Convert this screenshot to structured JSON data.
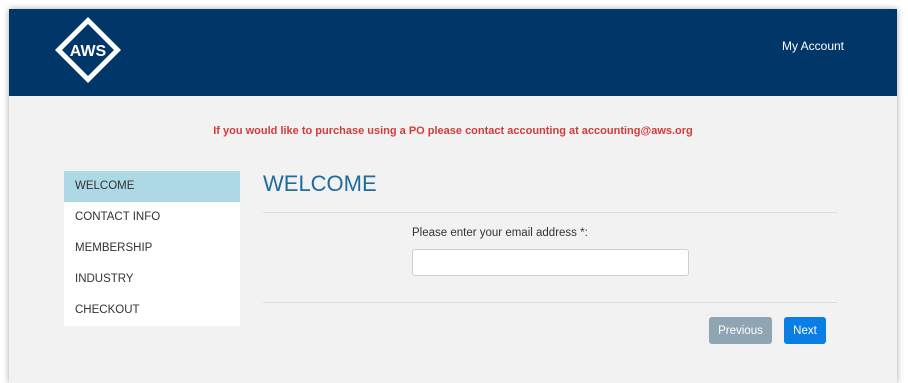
{
  "header": {
    "logo_text": "AWS",
    "my_account_label": "My Account",
    "background_color": "#003768"
  },
  "notice": {
    "text": "If you would like to purchase using a PO please contact accounting at accounting@aws.org",
    "color": "#d33b3b"
  },
  "sidebar": {
    "items": [
      {
        "label": "WELCOME",
        "active": true
      },
      {
        "label": "CONTACT INFO",
        "active": false
      },
      {
        "label": "MEMBERSHIP",
        "active": false
      },
      {
        "label": "INDUSTRY",
        "active": false
      },
      {
        "label": "CHECKOUT",
        "active": false
      }
    ],
    "active_color": "#add8e6"
  },
  "main": {
    "title": "WELCOME",
    "email_label": "Please enter your email address *:",
    "email_value": "",
    "email_placeholder": ""
  },
  "buttons": {
    "previous_label": "Previous",
    "next_label": "Next"
  }
}
